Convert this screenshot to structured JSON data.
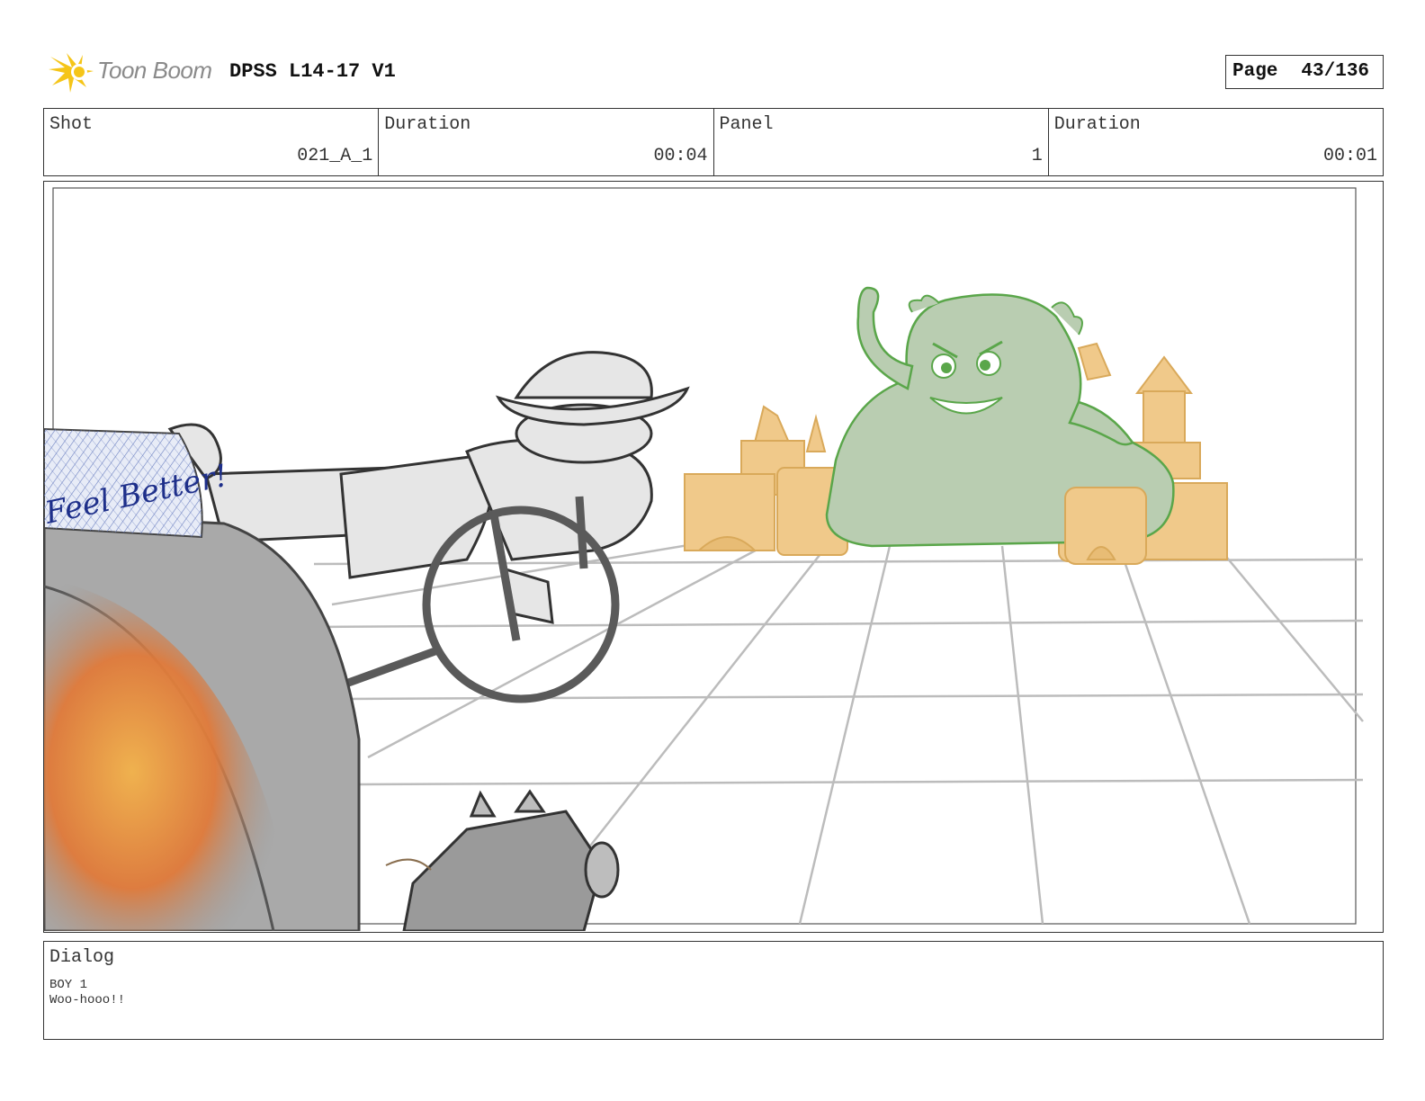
{
  "header": {
    "logo_text": "Toon Boom",
    "project_title": "DPSS L14-17 V1",
    "page_label": "Page",
    "page_value": "43/136"
  },
  "info": {
    "shot_label": "Shot",
    "shot_value": "021_A_1",
    "shot_duration_label": "Duration",
    "shot_duration_value": "00:04",
    "panel_label": "Panel",
    "panel_value": "1",
    "panel_duration_label": "Duration",
    "panel_duration_value": "00:01"
  },
  "panel_image": {
    "sign_text": "Feel Better!",
    "icons": [
      "toon-boom-logo-icon"
    ]
  },
  "dialog": {
    "label": "Dialog",
    "speaker": "BOY 1",
    "line": "Woo-hooo!!"
  },
  "colors": {
    "border": "#333333",
    "logo_yellow": "#f5c518",
    "monster_green": "#b9cdb1",
    "monster_outline": "#5aa64a",
    "sand": "#f0c98a",
    "sand_outline": "#d9a95a",
    "fire_orange": "#e07a3a"
  }
}
